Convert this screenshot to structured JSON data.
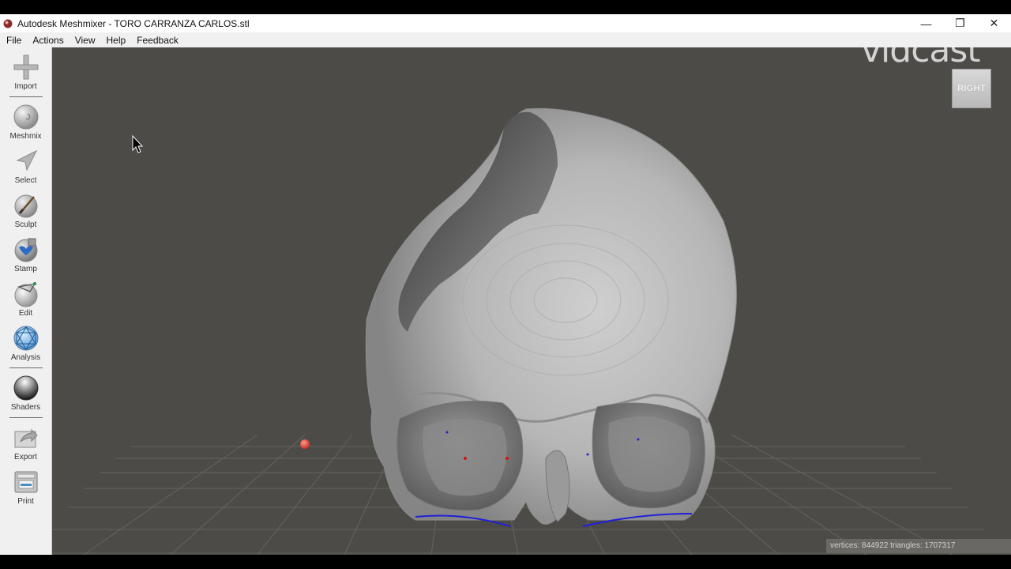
{
  "window": {
    "title": "Autodesk Meshmixer - TORO CARRANZA CARLOS.stl",
    "minimize_glyph": "—",
    "restore_glyph": "❐",
    "close_glyph": "✕"
  },
  "menu": [
    "File",
    "Actions",
    "View",
    "Help",
    "Feedback"
  ],
  "toolbar": {
    "items": [
      {
        "label": "Import",
        "icon": "plus-icon"
      },
      {
        "label": "Meshmix",
        "icon": "meshmix-sphere-icon"
      },
      {
        "label": "Select",
        "icon": "select-arrow-icon"
      },
      {
        "label": "Sculpt",
        "icon": "sculpt-brush-icon"
      },
      {
        "label": "Stamp",
        "icon": "stamp-icon"
      },
      {
        "label": "Edit",
        "icon": "edit-sphere-icon"
      },
      {
        "label": "Analysis",
        "icon": "analysis-sphere-icon"
      },
      {
        "label": "Shaders",
        "icon": "shaders-sphere-icon"
      },
      {
        "label": "Export",
        "icon": "export-icon"
      },
      {
        "label": "Print",
        "icon": "printer-icon"
      }
    ]
  },
  "viewport": {
    "view_cube_label": "RIGHT",
    "watermark": "vidcast",
    "stats": "vertices: 844922 triangles: 1707317",
    "background_color": "#4d4b47",
    "mesh_color": "#bdbdbd",
    "pivot_color": "#e2483c"
  }
}
